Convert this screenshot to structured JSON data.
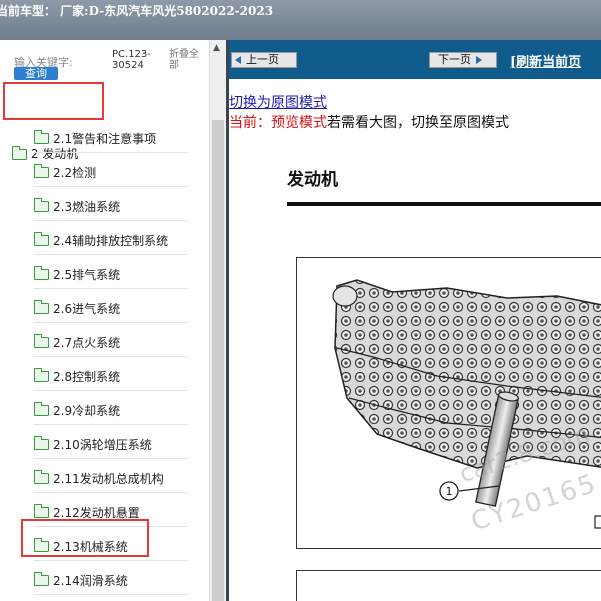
{
  "titlebar": {
    "text": "当前车型：  厂家:D-东风汽车风光5802022-2023"
  },
  "search": {
    "label": "输入关键字:",
    "button": "查询",
    "code": "PC.123-30524",
    "collapse_all": "折叠全部"
  },
  "tree": {
    "root": "2 发动机",
    "items": [
      "2.1警告和注意事项",
      "2.2检测",
      "2.3燃油系统",
      "2.4辅助排放控制系统",
      "2.5排气系统",
      "2.6进气系统",
      "2.7点火系统",
      "2.8控制系统",
      "2.9冷却系统",
      "2.10涡轮增压系统",
      "2.11发动机总成机构",
      "2.12发动机悬置",
      "2.13机械系统",
      "2.14润滑系统"
    ],
    "highlighted": [
      "2 发动机",
      "2.13机械系统"
    ]
  },
  "nav": {
    "prev": "上一页",
    "next": "下一页",
    "refresh": "[刷新当前页"
  },
  "content": {
    "switch_link": "切换为原图模式",
    "mode_current": "当前：预览模式",
    "mode_hint": "若需看大图，切换至原图模式",
    "doc_title": "发动机",
    "callout": "1",
    "watermark1": "car2.8.com",
    "watermark2": "CY20165"
  },
  "colors": {
    "navbar": "#0f5c8c",
    "highlight": "#e53935",
    "folder": "#3a9b3a",
    "link": "#1b1bb3",
    "mode_red": "#d11111"
  },
  "icons": {
    "tree_node": "folder-icon",
    "prev": "arrow-left-icon",
    "next": "arrow-right-icon",
    "scroll": "scroll-up-arrow-icon"
  }
}
